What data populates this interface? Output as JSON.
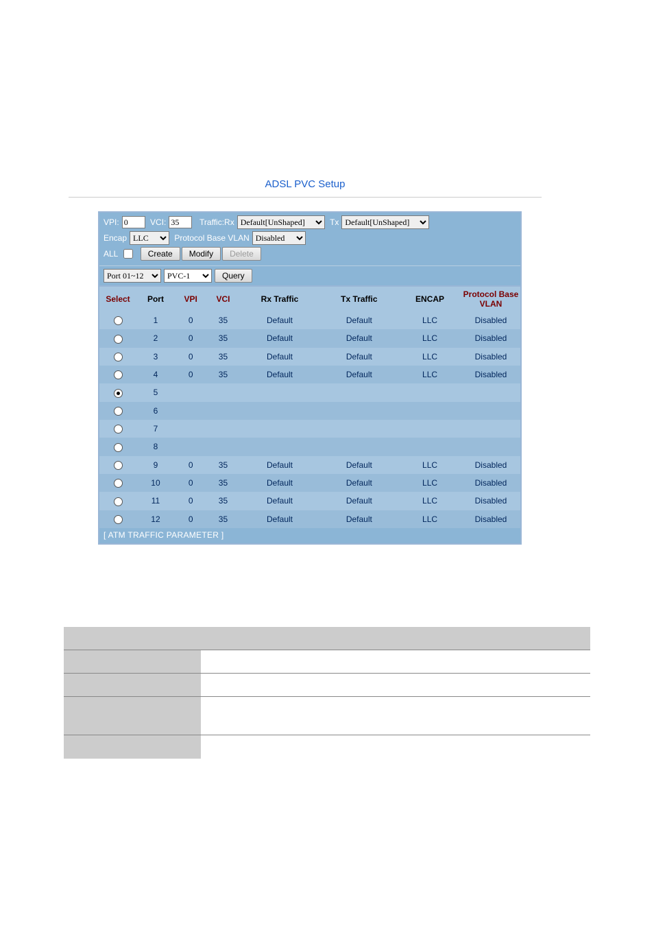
{
  "title": "ADSL PVC Setup",
  "form": {
    "vpi_label": "VPI:",
    "vpi_value": "0",
    "vci_label": "VCI:",
    "vci_value": "35",
    "traffic_rx_label": "Traffic:Rx",
    "traffic_rx_value": "Default[UnShaped]",
    "tx_label": "Tx",
    "tx_value": "Default[UnShaped]",
    "encap_label": "Encap",
    "encap_value": "LLC",
    "pbv_label": "Protocol Base VLAN",
    "pbv_value": "Disabled",
    "all_label": "ALL",
    "create_btn": "Create",
    "modify_btn": "Modify",
    "delete_btn": "Delete",
    "portrange_value": "Port 01~12",
    "pvc_value": "PVC-1",
    "query_btn": "Query"
  },
  "table": {
    "headers": {
      "select": "Select",
      "port": "Port",
      "vpi": "VPI",
      "vci": "VCI",
      "rx": "Rx Traffic",
      "tx": "Tx Traffic",
      "encap": "ENCAP",
      "pbv": "Protocol Base VLAN"
    },
    "rows": [
      {
        "sel": false,
        "port": "1",
        "vpi": "0",
        "vci": "35",
        "rx": "Default",
        "tx": "Default",
        "encap": "LLC",
        "pbv": "Disabled"
      },
      {
        "sel": false,
        "port": "2",
        "vpi": "0",
        "vci": "35",
        "rx": "Default",
        "tx": "Default",
        "encap": "LLC",
        "pbv": "Disabled"
      },
      {
        "sel": false,
        "port": "3",
        "vpi": "0",
        "vci": "35",
        "rx": "Default",
        "tx": "Default",
        "encap": "LLC",
        "pbv": "Disabled"
      },
      {
        "sel": false,
        "port": "4",
        "vpi": "0",
        "vci": "35",
        "rx": "Default",
        "tx": "Default",
        "encap": "LLC",
        "pbv": "Disabled"
      },
      {
        "sel": true,
        "port": "5",
        "vpi": "",
        "vci": "",
        "rx": "",
        "tx": "",
        "encap": "",
        "pbv": ""
      },
      {
        "sel": false,
        "port": "6",
        "vpi": "",
        "vci": "",
        "rx": "",
        "tx": "",
        "encap": "",
        "pbv": ""
      },
      {
        "sel": false,
        "port": "7",
        "vpi": "",
        "vci": "",
        "rx": "",
        "tx": "",
        "encap": "",
        "pbv": ""
      },
      {
        "sel": false,
        "port": "8",
        "vpi": "",
        "vci": "",
        "rx": "",
        "tx": "",
        "encap": "",
        "pbv": ""
      },
      {
        "sel": false,
        "port": "9",
        "vpi": "0",
        "vci": "35",
        "rx": "Default",
        "tx": "Default",
        "encap": "LLC",
        "pbv": "Disabled"
      },
      {
        "sel": false,
        "port": "10",
        "vpi": "0",
        "vci": "35",
        "rx": "Default",
        "tx": "Default",
        "encap": "LLC",
        "pbv": "Disabled"
      },
      {
        "sel": false,
        "port": "11",
        "vpi": "0",
        "vci": "35",
        "rx": "Default",
        "tx": "Default",
        "encap": "LLC",
        "pbv": "Disabled"
      },
      {
        "sel": false,
        "port": "12",
        "vpi": "0",
        "vci": "35",
        "rx": "Default",
        "tx": "Default",
        "encap": "LLC",
        "pbv": "Disabled"
      }
    ]
  },
  "footer_link": "[ ATM TRAFFIC PARAMETER ]"
}
